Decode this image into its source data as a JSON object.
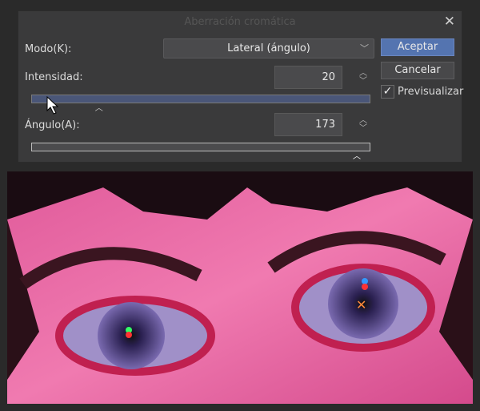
{
  "dialog": {
    "title": "Aberración cromática",
    "mode_label": "Modo(K):",
    "mode_value": "Lateral (ángulo)",
    "intensity_label": "Intensidad:",
    "intensity_value": "20",
    "intensity_fraction": 0.2,
    "angle_label": "Ángulo(A):",
    "angle_value": "173",
    "angle_fraction": 0.96,
    "ok": "Aceptar",
    "cancel": "Cancelar",
    "preview": "Previsualizar",
    "preview_checked": true
  },
  "colors": {
    "accent": "#5474b0",
    "dialog_bg": "#3a3a3b",
    "slider_fill": "#4a5678"
  }
}
